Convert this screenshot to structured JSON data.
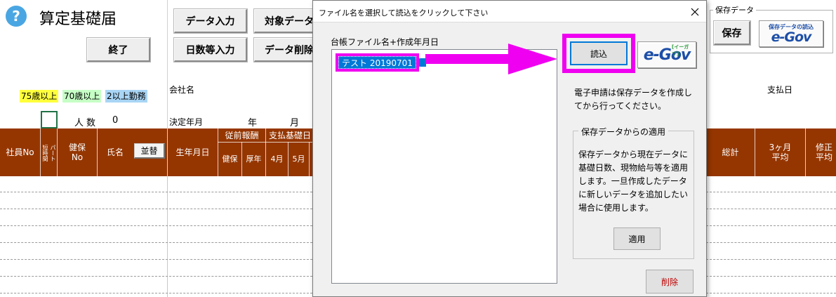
{
  "header": {
    "help_icon": "question-mark-icon",
    "title": "算定基礎届",
    "end_button": "終了"
  },
  "toolbar": {
    "data_input": "データ入力",
    "target_data": "対象データ",
    "days_input": "日数等入力",
    "data_delete": "データ削除"
  },
  "legend": {
    "age75": "75歳以上",
    "age70": "70歳以上",
    "multi_work": "2以上勤務",
    "colors": {
      "age75": "#ffff3c",
      "age70": "#c6ffc6",
      "multi_work": "#a9d5f5"
    }
  },
  "info": {
    "company_label": "会社名",
    "headcount_label": "人数",
    "headcount_value": "0",
    "decision_label": "決定年月",
    "year_label": "年",
    "month_label": "月",
    "payday_label": "支払日"
  },
  "table": {
    "header_color": "#953600",
    "col_employee_no": "社員No",
    "col_short_time": "短時間",
    "col_part": "パート",
    "col_health_no_line1": "健保",
    "col_health_no_line2": "No",
    "col_name": "氏名",
    "sort_button": "並替",
    "col_birthdate": "生年月日",
    "group_prev_salary": "従前報酬",
    "sub_health": "健保",
    "sub_pension": "厚年",
    "group_base_days": "支払基礎日",
    "sub_apr": "4月",
    "sub_may": "5月",
    "col_total": "総計",
    "col_avg_line1": "3ヶ月",
    "col_avg_line2": "平均",
    "col_revised_line1": "修正",
    "col_revised_line2": "平均"
  },
  "saved_panel": {
    "group_label": "保存データ",
    "save_button": "保存",
    "load_caption": "保存データの読込",
    "egov_logo": "e-Gov"
  },
  "dialog": {
    "title": "ファイル名を選択して読込をクリックして下さい",
    "close_icon": "close-icon",
    "list_label": "台帳ファイル名+作成年月日",
    "items": [
      "テスト 20190701"
    ],
    "load_button": "読込",
    "egov_logo": "e-Gov",
    "egov_sub": "[イーガブ]",
    "note": "電子申請は保存データを作成してから行ってください。",
    "apply_group_label": "保存データからの適用",
    "apply_description": "保存データから現在データに基礎日数、現物給与等を適用します。一旦作成したデータに新しいデータを追加したい場合に使用します。",
    "apply_button": "適用",
    "delete_button": "削除",
    "highlight_color": "#f000f0"
  }
}
